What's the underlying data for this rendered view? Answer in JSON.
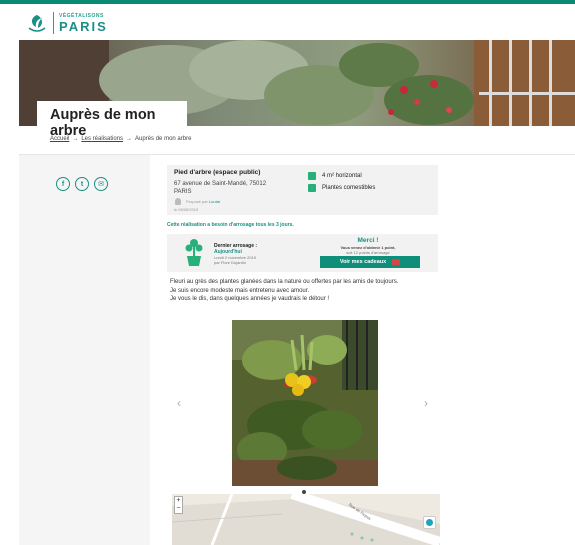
{
  "brand": {
    "top_line": "VÉGÉTALISONS",
    "city": "PARIS",
    "accent_color": "#0a8a73"
  },
  "page": {
    "title": "Auprès de mon arbre"
  },
  "breadcrumb": {
    "home": "Accueil",
    "achievements": "Les réalisations",
    "current": "Auprès de mon arbre",
    "separator": "→"
  },
  "social": {
    "facebook": "f",
    "twitter": "t",
    "email": "✉"
  },
  "info": {
    "type": "Pied d'arbre (espace public)",
    "address": "67 avenue de Saint-Mandé, 75012 PARIS",
    "proposed_label": "Proposé par",
    "proposed_by": "Loutar",
    "date": "le 05/05/2019",
    "surface": "4 m² horizontal",
    "plants": "Plantes comestibles"
  },
  "watering": {
    "note": "Cette réalisation a besoin d'arrosage tous les 3 jours.",
    "last_label": "Dernier arrosage :",
    "last_value": "Aujourd'hui",
    "last_date": "Lundi 2 novembre 2019",
    "last_by": "par Flore Dujardin",
    "thanks": "Merci !",
    "points": "Vous venez d'obtenir 1 point,",
    "total": "soit 12 points d'arrosage",
    "gift_button": "Voir mes cadeaux"
  },
  "description": {
    "line1": "Fleuri au grès des plantes glanées dans la nature ou offertes par les amis de toujours.",
    "line2": "Je suis encore modeste mais entretenu avec amour.",
    "line3": "Je vous le dis, dans quelques années je vaudrais le détour !"
  },
  "carousel": {
    "prev": "‹",
    "next": "›"
  },
  "map": {
    "zoom_in": "+",
    "zoom_out": "−",
    "street": "Rue de Picpus"
  }
}
